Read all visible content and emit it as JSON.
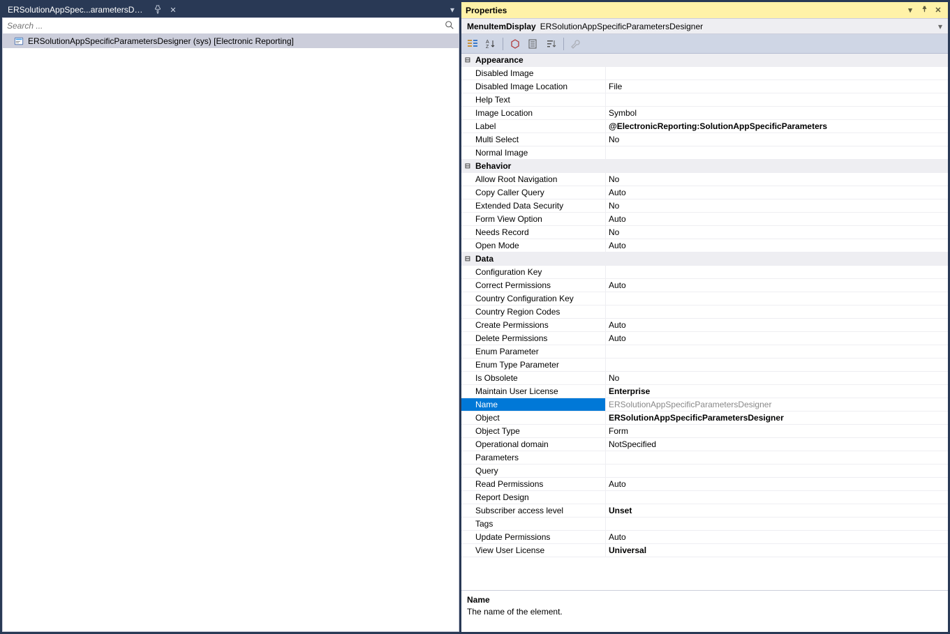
{
  "tab": {
    "title": "ERSolutionAppSpec...arametersDesigner"
  },
  "search": {
    "placeholder": "Search ..."
  },
  "tree": {
    "root_label": "ERSolutionAppSpecificParametersDesigner (sys) [Electronic Reporting]"
  },
  "properties": {
    "title": "Properties",
    "selector_type": "MenuItemDisplay",
    "selector_name": "ERSolutionAppSpecificParametersDesigner",
    "categories": [
      {
        "name": "Appearance",
        "rows": [
          {
            "label": "Disabled Image",
            "value": ""
          },
          {
            "label": "Disabled Image Location",
            "value": "File"
          },
          {
            "label": "Help Text",
            "value": ""
          },
          {
            "label": "Image Location",
            "value": "Symbol"
          },
          {
            "label": "Label",
            "value": "@ElectronicReporting:SolutionAppSpecificParameters",
            "bold": true
          },
          {
            "label": "Multi Select",
            "value": "No"
          },
          {
            "label": "Normal Image",
            "value": ""
          }
        ]
      },
      {
        "name": "Behavior",
        "rows": [
          {
            "label": "Allow Root Navigation",
            "value": "No"
          },
          {
            "label": "Copy Caller Query",
            "value": "Auto"
          },
          {
            "label": "Extended Data Security",
            "value": "No"
          },
          {
            "label": "Form View Option",
            "value": "Auto"
          },
          {
            "label": "Needs Record",
            "value": "No"
          },
          {
            "label": "Open Mode",
            "value": "Auto"
          }
        ]
      },
      {
        "name": "Data",
        "rows": [
          {
            "label": "Configuration Key",
            "value": ""
          },
          {
            "label": "Correct Permissions",
            "value": "Auto"
          },
          {
            "label": "Country Configuration Key",
            "value": ""
          },
          {
            "label": "Country Region Codes",
            "value": ""
          },
          {
            "label": "Create Permissions",
            "value": "Auto"
          },
          {
            "label": "Delete Permissions",
            "value": "Auto"
          },
          {
            "label": "Enum Parameter",
            "value": ""
          },
          {
            "label": "Enum Type Parameter",
            "value": ""
          },
          {
            "label": "Is Obsolete",
            "value": "No"
          },
          {
            "label": "Maintain User License",
            "value": "Enterprise",
            "bold": true
          },
          {
            "label": "Name",
            "value": "ERSolutionAppSpecificParametersDesigner",
            "selected": true
          },
          {
            "label": "Object",
            "value": "ERSolutionAppSpecificParametersDesigner",
            "bold": true
          },
          {
            "label": "Object Type",
            "value": "Form"
          },
          {
            "label": "Operational domain",
            "value": "NotSpecified"
          },
          {
            "label": "Parameters",
            "value": ""
          },
          {
            "label": "Query",
            "value": ""
          },
          {
            "label": "Read Permissions",
            "value": "Auto"
          },
          {
            "label": "Report Design",
            "value": ""
          },
          {
            "label": "Subscriber access level",
            "value": "Unset",
            "bold": true
          },
          {
            "label": "Tags",
            "value": ""
          },
          {
            "label": "Update Permissions",
            "value": "Auto"
          },
          {
            "label": "View User License",
            "value": "Universal",
            "bold": true
          }
        ]
      }
    ],
    "description": {
      "name": "Name",
      "text": "The name of the element."
    }
  }
}
